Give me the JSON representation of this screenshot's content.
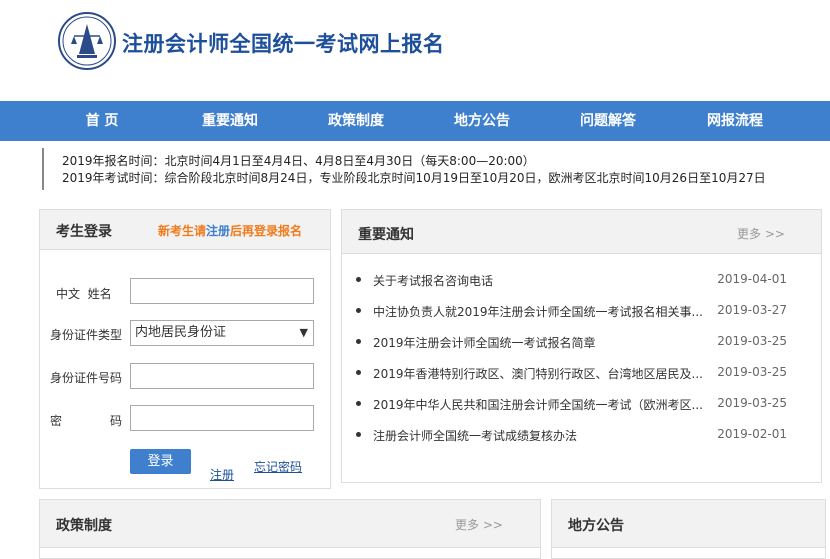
{
  "header": {
    "site_title": "注册会计师全国统一考试网上报名"
  },
  "nav": {
    "items": [
      "首 页",
      "重要通知",
      "政策制度",
      "地方公告",
      "问题解答",
      "网报流程"
    ]
  },
  "banner": {
    "line1": "2019年报名时间：北京时间4月1日至4月4日、4月8日至4月30日（每天8:00—20:00）",
    "line2": "2019年考试时间：综合阶段北京时间8月24日，专业阶段北京时间10月19日至10月20日，欧洲考区北京时间10月26日至10月27日"
  },
  "login": {
    "title": "考生登录",
    "tip_pre": "新考生请",
    "tip_link": "注册",
    "tip_post": "后再登录报名",
    "name_label": "中文  姓名",
    "idtype_label": "身份证件类型",
    "idtype_value": "内地居民身份证",
    "idnum_label": "身份证件号码",
    "pwd_label_1": "密",
    "pwd_label_2": "码",
    "login_button": "登录",
    "register_link": "注册",
    "forgot_link": "忘记密码"
  },
  "notices": {
    "title": "重要通知",
    "more": "更多 >>",
    "items": [
      {
        "title": "关于考试报名咨询电话",
        "date": "2019-04-01"
      },
      {
        "title": "中注协负责人就2019年注册会计师全国统一考试报名相关事...",
        "date": "2019-03-27"
      },
      {
        "title": "2019年注册会计师全国统一考试报名简章",
        "date": "2019-03-25"
      },
      {
        "title": "2019年香港特别行政区、澳门特别行政区、台湾地区居民及...",
        "date": "2019-03-25"
      },
      {
        "title": "2019年中华人民共和国注册会计师全国统一考试（欧洲考区...",
        "date": "2019-03-25"
      },
      {
        "title": "注册会计师全国统一考试成绩复核办法",
        "date": "2019-02-01"
      }
    ]
  },
  "policy": {
    "title": "政策制度",
    "more": "更多 >>"
  },
  "local": {
    "title": "地方公告"
  }
}
